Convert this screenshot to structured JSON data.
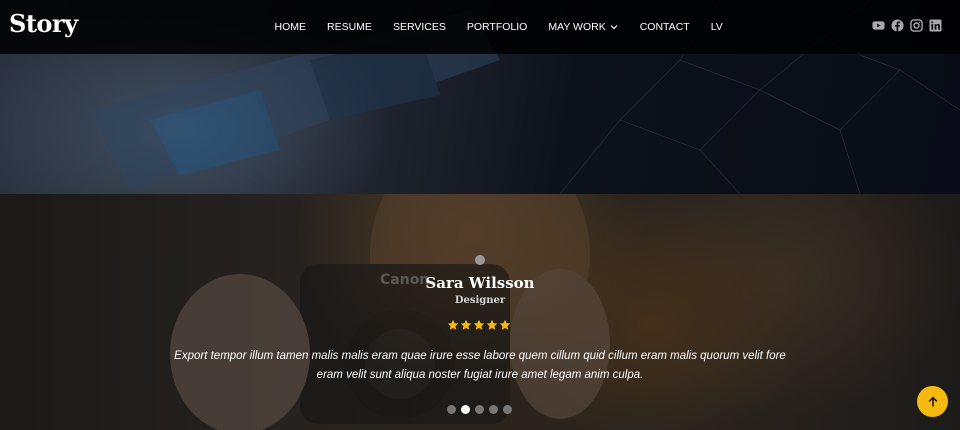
{
  "header": {
    "logo": "Story",
    "nav": [
      {
        "label": "HOME"
      },
      {
        "label": "RESUME"
      },
      {
        "label": "SERVICES"
      },
      {
        "label": "PORTFOLIO"
      },
      {
        "label": "MAY WORK"
      },
      {
        "label": "CONTACT"
      },
      {
        "label": "LV"
      }
    ],
    "socials": [
      "youtube-icon",
      "facebook-icon",
      "instagram-icon",
      "linkedin-icon"
    ]
  },
  "testimonial": {
    "name": "Sara Wilsson",
    "role": "Designer",
    "rating": 5,
    "quote": "Export tempor illum tamen malis malis eram quae irure esse labore quem cillum quid cillum eram malis quorum velit fore eram velit sunt aliqua noster fugiat irure amet legam anim culpa.",
    "slide_count": 5,
    "active_slide": 2
  },
  "colors": {
    "accent": "#f5b90f",
    "star": "#f5b90f",
    "header_bg": "#000000"
  }
}
